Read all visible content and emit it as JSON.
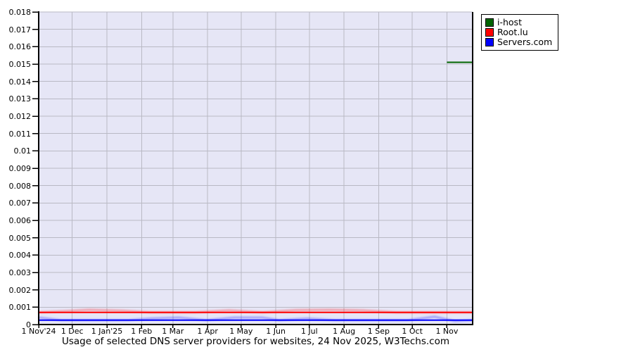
{
  "legend": {
    "items": [
      {
        "label": "i-host",
        "color": "#006400"
      },
      {
        "label": "Root.lu",
        "color": "#ff0000"
      },
      {
        "label": "Servers.com",
        "color": "#0000ff"
      }
    ]
  },
  "chart_data": {
    "type": "line",
    "title": "Usage of selected DNS server providers for websites, 24 Nov 2025, W3Techs.com",
    "xlabel": "",
    "ylabel": "",
    "ylim": [
      0,
      0.018
    ],
    "y_tick_step": 0.001,
    "grid": true,
    "legend_position": "top-right",
    "plot_bg_color": "#e6e6f6",
    "grid_color": "#b9b9c4",
    "axis_color": "#000000",
    "x_tick_labels": [
      "1 Nov'24",
      "1 Dec",
      "1 Jan'25",
      "1 Feb",
      "1 Mar",
      "1 Apr",
      "1 May",
      "1 Jun",
      "1 Jul",
      "1 Aug",
      "1 Sep",
      "1 Oct",
      "1 Nov"
    ],
    "x_tick_days": [
      0,
      30,
      61,
      92,
      120,
      151,
      181,
      212,
      242,
      273,
      304,
      334,
      365
    ],
    "x_total_days": 388,
    "series": [
      {
        "name": "i-host",
        "color": "#006400",
        "hide_zero": true,
        "points": [
          [
            0,
            0
          ],
          [
            30,
            0
          ],
          [
            61,
            0
          ],
          [
            92,
            0
          ],
          [
            120,
            0
          ],
          [
            151,
            0
          ],
          [
            181,
            0
          ],
          [
            212,
            0
          ],
          [
            242,
            0
          ],
          [
            273,
            0
          ],
          [
            304,
            0
          ],
          [
            334,
            0
          ],
          [
            365,
            0.0151
          ],
          [
            388,
            0.0151
          ]
        ]
      },
      {
        "name": "Root.lu",
        "color": "#ff0000",
        "points": [
          [
            0,
            0.0007
          ],
          [
            30,
            0.0007
          ],
          [
            61,
            0.0007
          ],
          [
            92,
            0.0007
          ],
          [
            120,
            0.0007
          ],
          [
            151,
            0.0007
          ],
          [
            181,
            0.0007
          ],
          [
            212,
            0.0007
          ],
          [
            242,
            0.0007
          ],
          [
            273,
            0.0007
          ],
          [
            304,
            0.0007
          ],
          [
            334,
            0.0007
          ],
          [
            365,
            0.0007
          ],
          [
            388,
            0.0007
          ]
        ],
        "soft_points": [
          [
            0,
            0.0007
          ],
          [
            25,
            0.00078
          ],
          [
            45,
            0.00085
          ],
          [
            75,
            0.0008
          ],
          [
            100,
            0.0007
          ],
          [
            140,
            0.0007
          ],
          [
            170,
            0.00082
          ],
          [
            200,
            0.0007
          ],
          [
            230,
            0.00083
          ],
          [
            260,
            0.00085
          ],
          [
            290,
            0.00082
          ],
          [
            320,
            0.0007
          ],
          [
            388,
            0.0007
          ]
        ]
      },
      {
        "name": "Servers.com",
        "color": "#0000ff",
        "points": [
          [
            0,
            0.00025
          ],
          [
            30,
            0.00025
          ],
          [
            61,
            0.00025
          ],
          [
            92,
            0.00025
          ],
          [
            120,
            0.00025
          ],
          [
            151,
            0.00025
          ],
          [
            181,
            0.00025
          ],
          [
            212,
            0.00025
          ],
          [
            242,
            0.00025
          ],
          [
            273,
            0.00025
          ],
          [
            304,
            0.00025
          ],
          [
            334,
            0.00025
          ],
          [
            365,
            0.00025
          ],
          [
            388,
            0.00025
          ]
        ],
        "soft_points": [
          [
            0,
            0.0004
          ],
          [
            20,
            0.00025
          ],
          [
            80,
            0.00025
          ],
          [
            100,
            0.00035
          ],
          [
            125,
            0.0004
          ],
          [
            150,
            0.00025
          ],
          [
            175,
            0.0004
          ],
          [
            200,
            0.0004
          ],
          [
            215,
            0.00025
          ],
          [
            240,
            0.00035
          ],
          [
            265,
            0.00025
          ],
          [
            330,
            0.00025
          ],
          [
            354,
            0.00045
          ],
          [
            372,
            0.0002
          ],
          [
            388,
            0.00025
          ]
        ]
      }
    ]
  }
}
